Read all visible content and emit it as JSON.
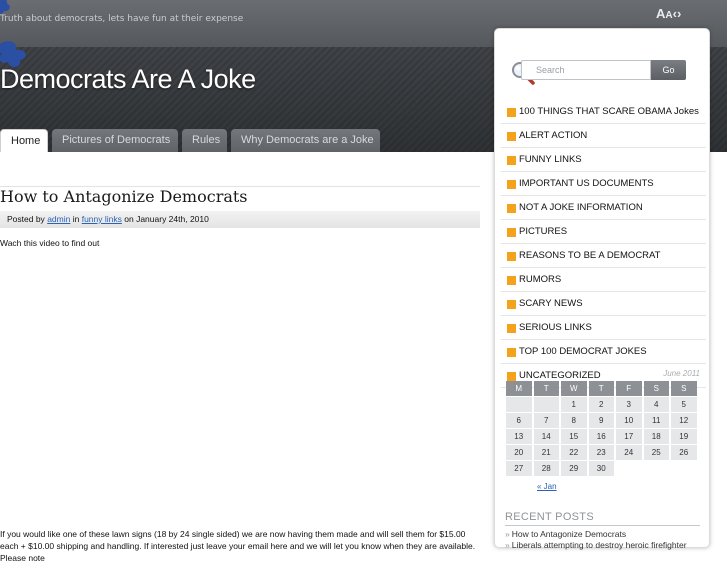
{
  "header": {
    "tagline": "Truth about democrats, lets have fun at their expense",
    "site_title": "Democrats Are A Joke",
    "font_tool_large": "A",
    "font_tool_small": "A",
    "font_tool_arrows": "‹›"
  },
  "nav": {
    "tabs": [
      {
        "label": "Home",
        "active": true
      },
      {
        "label": "Pictures of Democrats",
        "active": false
      },
      {
        "label": "Rules",
        "active": false
      },
      {
        "label": "Why Democrats are a Joke",
        "active": false
      }
    ]
  },
  "post": {
    "title": "How to Antagonize Democrats",
    "meta_posted_by": "Posted by",
    "meta_author": "admin",
    "meta_in": "in",
    "meta_category": "funny links",
    "meta_date": "on January 24th, 2010",
    "intro": "Wach this video to find out",
    "body": "If you would like one of these lawn signs (18 by 24 single sided) we are now having them made and will sell them for $15.00 each + $10.00 shipping and handling. If interested just leave your email here and we will let you know when they are available. Please note"
  },
  "sidebar": {
    "search_placeholder": "Search",
    "search_button": "Go",
    "categories": [
      "100 THINGS THAT SCARE OBAMA Jokes",
      "ALERT ACTION",
      "FUNNY LINKS",
      "IMPORTANT US DOCUMENTS",
      "NOT A JOKE INFORMATION",
      "PICTURES",
      "REASONS TO BE A DEMOCRAT",
      "RUMORS",
      "SCARY NEWS",
      "SERIOUS LINKS",
      "TOP 100 DEMOCRAT JOKES",
      "UNCATEGORIZED"
    ],
    "calendar": {
      "caption": "June 2011",
      "days": [
        "M",
        "T",
        "W",
        "T",
        "F",
        "S",
        "S"
      ],
      "weeks": [
        [
          "",
          "",
          "1",
          "2",
          "3",
          "4",
          "5"
        ],
        [
          "6",
          "7",
          "8",
          "9",
          "10",
          "11",
          "12"
        ],
        [
          "13",
          "14",
          "15",
          "16",
          "17",
          "18",
          "19"
        ],
        [
          "20",
          "21",
          "22",
          "23",
          "24",
          "25",
          "26"
        ],
        [
          "27",
          "28",
          "29",
          "30",
          "",
          "",
          ""
        ]
      ],
      "prev_link": "« Jan"
    },
    "recent_heading": "RECENT POSTS",
    "recent_posts": [
      "How to Antagonize Democrats",
      "Liberals attempting to destroy heroic firefighter"
    ]
  },
  "colors": {
    "accent_orange": "#f4a21b",
    "link_blue": "#2b62b7",
    "header_dark": "#3a3d41"
  }
}
